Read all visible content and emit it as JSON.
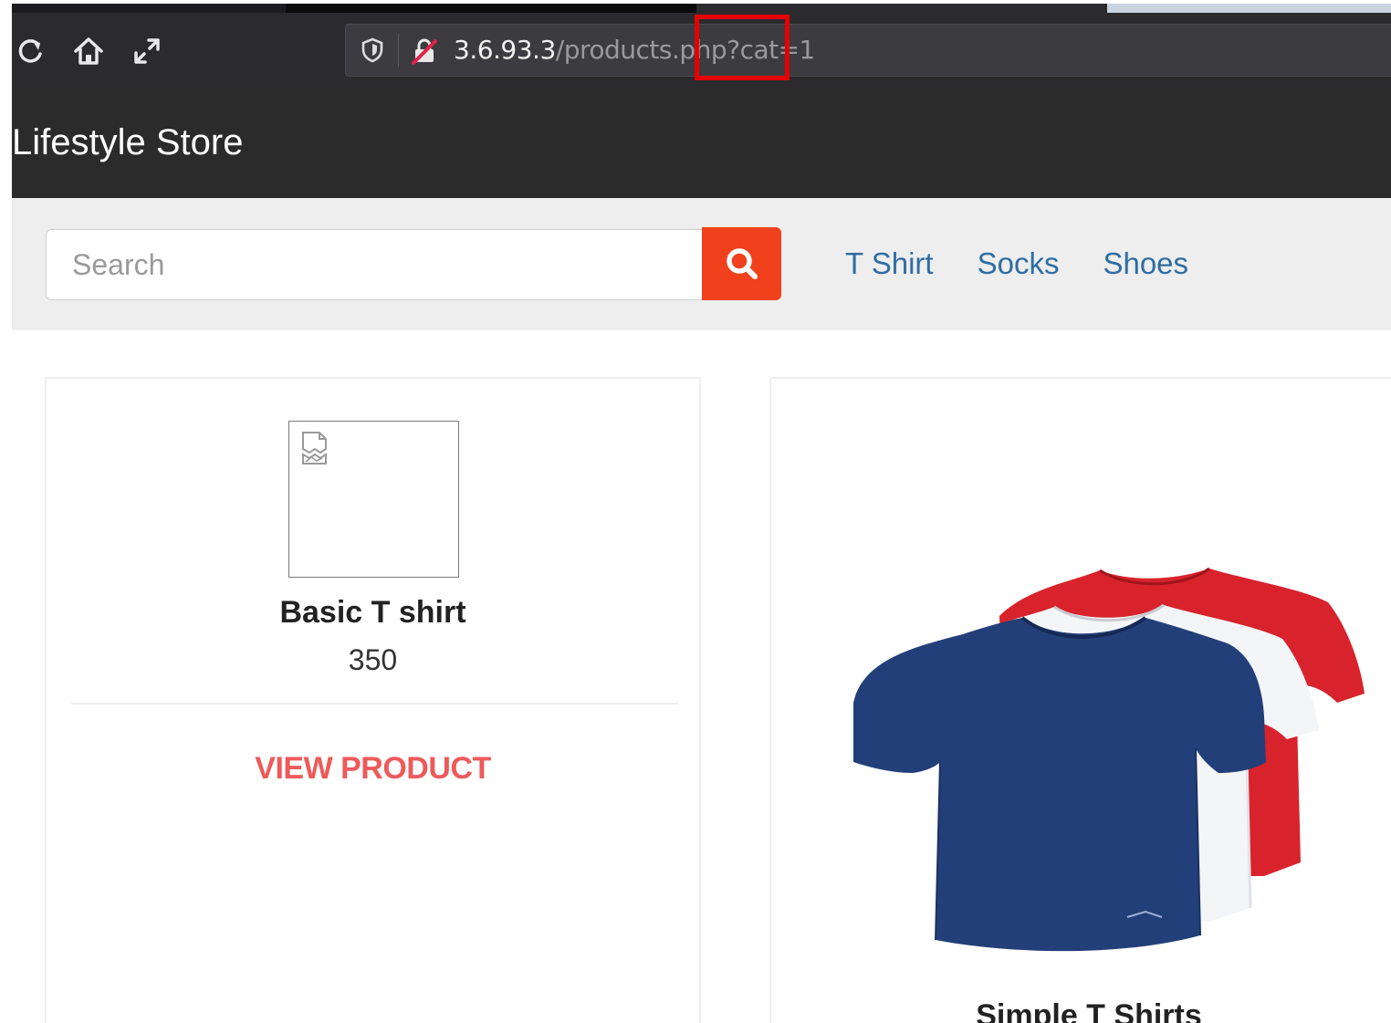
{
  "browser": {
    "url_host": "3.6.93.3",
    "url_path": "/products.php",
    "url_query": "?cat=1"
  },
  "site": {
    "brand": "Lifestyle Store"
  },
  "search": {
    "placeholder": "Search"
  },
  "nav": {
    "items": [
      {
        "label": "T Shirt"
      },
      {
        "label": "Socks"
      },
      {
        "label": "Shoes"
      }
    ]
  },
  "products": [
    {
      "name": "Basic T shirt",
      "price": "350",
      "action": "VIEW PRODUCT"
    },
    {
      "name": "Simple T Shirts"
    }
  ],
  "colors": {
    "toolbar": "#2b2a2d",
    "header": "#2b2b2b",
    "search_button": "#f0401c",
    "nav_link": "#2f6da3",
    "view_product": "#ee5a5a",
    "highlight": "#e60000"
  },
  "icons": [
    "reload-icon",
    "home-icon",
    "expand-icon",
    "shield-icon",
    "insecure-lock-icon",
    "search-icon",
    "broken-image-icon"
  ]
}
